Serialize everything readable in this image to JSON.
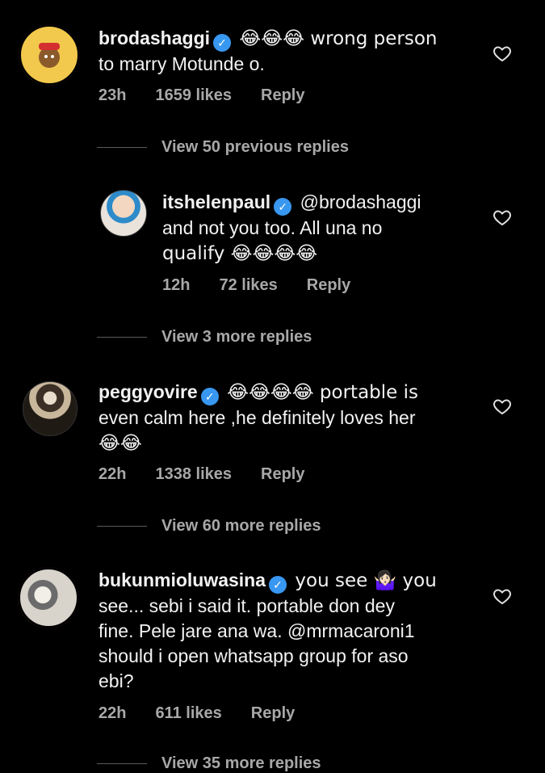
{
  "comments": [
    {
      "username": "brodashaggi",
      "text_line1": "😂😂😂 wrong person",
      "text_line2": "to marry Motunde o.",
      "time": "23h",
      "likes": "1659 likes",
      "reply": "Reply",
      "view_replies": "View 50 previous replies"
    },
    {
      "username": "itshelenpaul",
      "text_line1": "@brodashaggi",
      "text_line2": "and not you too. All una no",
      "text_line3": "qualify 😂😂😂😂",
      "time": "12h",
      "likes": "72 likes",
      "reply": "Reply",
      "view_replies": "View 3 more replies"
    },
    {
      "username": "peggyovire",
      "text_line1": "😂😂😂😂 portable is",
      "text_line2": "even calm here ,he definitely loves her",
      "text_line3": "😂😂",
      "time": "22h",
      "likes": "1338 likes",
      "reply": "Reply",
      "view_replies": "View 60 more replies"
    },
    {
      "username": "bukunmioluwasina",
      "text_line1": "you see 🤷🏻‍♀️ you",
      "text_line2": "see... sebi i said it. portable don dey",
      "text_line3": "fine. Pele jare ana wa.  @mrmacaroni1",
      "text_line4": "should i open whatsapp group for aso",
      "text_line5": "ebi?",
      "time": "22h",
      "likes": "611 likes",
      "reply": "Reply",
      "view_replies": "View 35 more replies"
    }
  ],
  "icons": {
    "verified": "verified-badge-icon",
    "like": "heart-outline-icon"
  },
  "colors": {
    "background": "#000000",
    "verified": "#3897f0",
    "meta": "#a8a8a8"
  }
}
